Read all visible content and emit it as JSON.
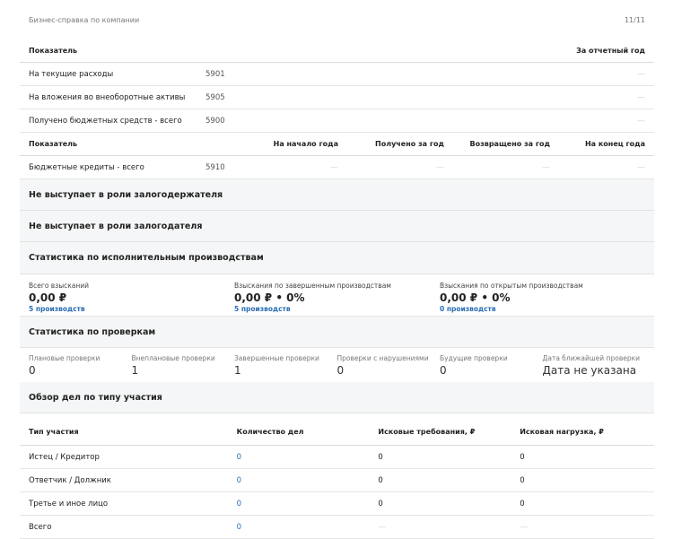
{
  "header": {
    "title": "Бизнес-справка по компании",
    "page": "11/11"
  },
  "table1": {
    "col_indicator": "Показатель",
    "col_period": "За отчетный год",
    "rows": [
      {
        "label": "На текущие расходы",
        "code": "5901",
        "value": "—"
      },
      {
        "label": "На вложения во внеоборотные активы",
        "code": "5905",
        "value": "—"
      },
      {
        "label": "Получено бюджетных средств - всего",
        "code": "5900",
        "value": "—"
      }
    ]
  },
  "table2": {
    "col_indicator": "Показатель",
    "col_start": "На начало года",
    "col_received": "Получено за год",
    "col_returned": "Возвращено за год",
    "col_end": "На конец года",
    "row": {
      "label": "Бюджетные кредиты - всего",
      "code": "5910",
      "start": "—",
      "received": "—",
      "returned": "—",
      "end": "—"
    }
  },
  "sections": {
    "pledge_holder": "Не выступает в роли залогодержателя",
    "pledger": "Не выступает в роли залогодателя",
    "enforcement": "Статистика по исполнительным производствам",
    "inspections": "Статистика по проверкам",
    "cases": "Обзор дел по типу участия"
  },
  "enforcement": [
    {
      "label": "Всего взысканий",
      "value": "0,00 ₽",
      "link": "5 производств"
    },
    {
      "label": "Взыскания по завершенным производствам",
      "value": "0,00 ₽ • 0%",
      "link": "5 производств"
    },
    {
      "label": "Взыскания по открытым производствам",
      "value": "0,00 ₽ • 0%",
      "link": "0 производств"
    }
  ],
  "inspections": [
    {
      "label": "Плановые проверки",
      "value": "0"
    },
    {
      "label": "Внеплановые проверки",
      "value": "1"
    },
    {
      "label": "Завершенные проверки",
      "value": "1"
    },
    {
      "label": "Проверки с нарушениями",
      "value": "0"
    },
    {
      "label": "Будущие проверки",
      "value": "0"
    },
    {
      "label": "Дата ближайшей проверки",
      "value": "Дата не указана"
    }
  ],
  "cases": {
    "headers": [
      "Тип участия",
      "Количество дел",
      "Исковые требования, ₽",
      "Исковая нагрузка, ₽"
    ],
    "rows": [
      {
        "type": "Истец / Кредитор",
        "count": "0",
        "claims": "0",
        "load": "0"
      },
      {
        "type": "Ответчик / Должник",
        "count": "0",
        "claims": "0",
        "load": "0"
      },
      {
        "type": "Третье и иное лицо",
        "count": "0",
        "claims": "0",
        "load": "0"
      },
      {
        "type": "Всего",
        "count": "0",
        "claims": "—",
        "load": "—"
      }
    ]
  },
  "colors": {
    "link": "#2a6db3",
    "section_bg": "#f5f6f7"
  }
}
